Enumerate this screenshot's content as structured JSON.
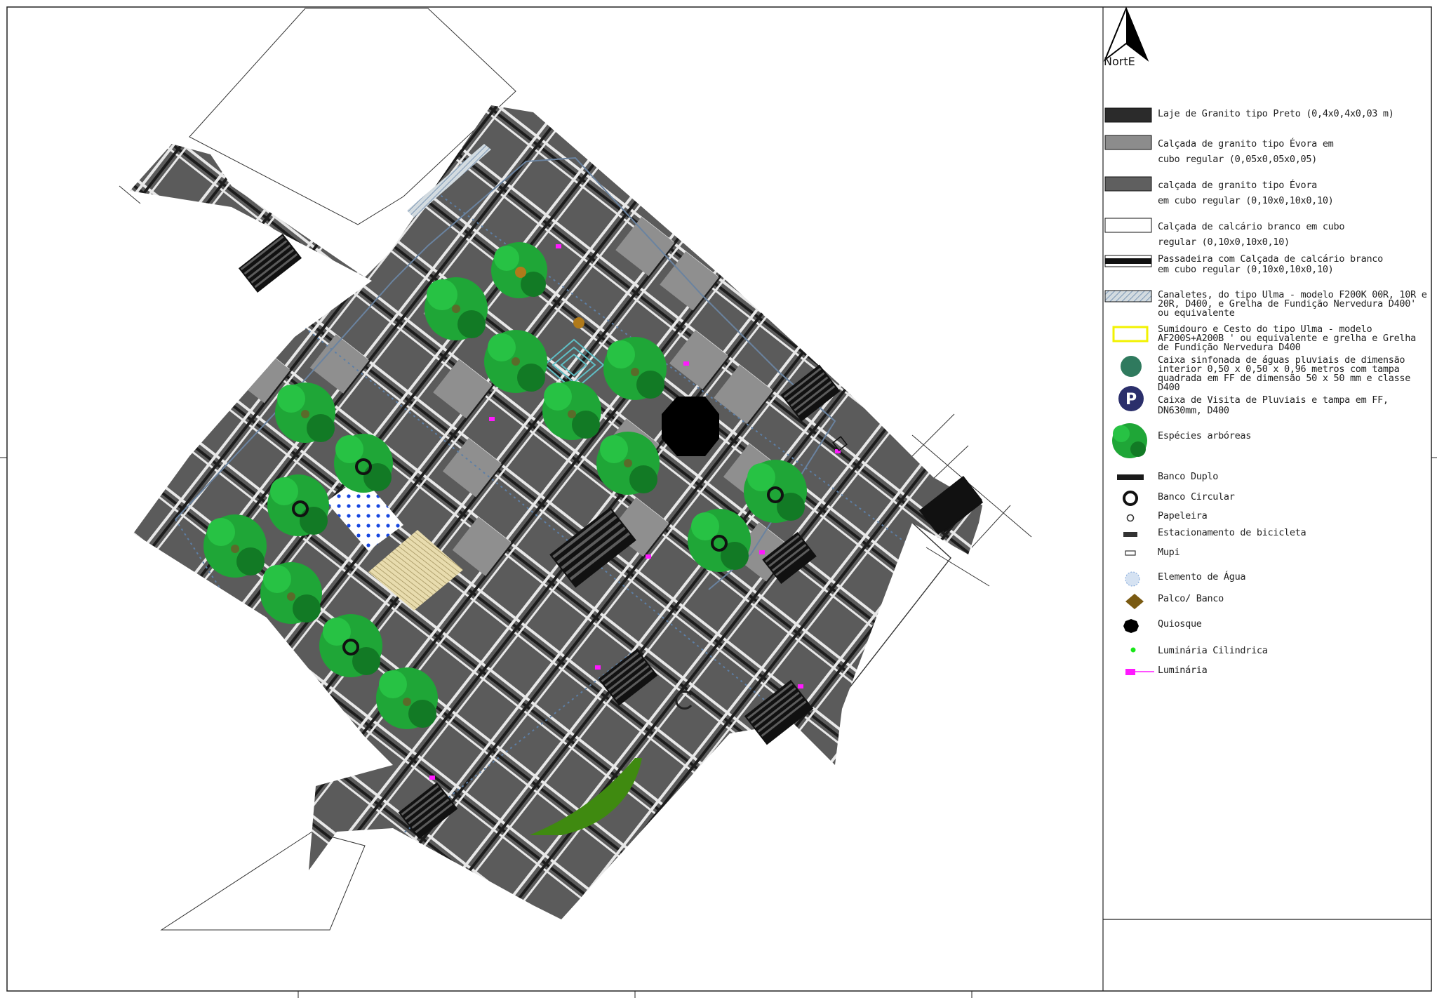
{
  "north": {
    "label": "NortE"
  },
  "legend": [
    {
      "id": "laje-granito-preto",
      "lines": [
        "Laje de Granito tipo Preto (0,4x0,4x0,03 m)"
      ],
      "symbol": "rect",
      "fill": "#2b2b2b"
    },
    {
      "id": "calcada-evora-cubo",
      "lines": [
        "Calçada de granito tipo Évora em",
        "cubo regular (0,05x0,05x0,05)"
      ],
      "symbol": "rect",
      "fill": "#8c8c8c"
    },
    {
      "id": "calcada-evora-10",
      "lines": [
        "calçada de granito tipo Évora",
        "em cubo regular (0,10x0,10x0,10)"
      ],
      "symbol": "rect",
      "fill": "#5f5f5f"
    },
    {
      "id": "calcada-calcario-branco",
      "lines": [
        "Calçada de calcário branco em cubo",
        "regular (0,10x0,10x0,10)"
      ],
      "symbol": "rect",
      "fill": "#ffffff"
    },
    {
      "id": "passadeira",
      "lines": [
        "Passadeira com Calçada de calcário branco",
        "em cubo regular (0,10x0,10x0,10)"
      ],
      "symbol": "stripe",
      "fill": "#111111"
    },
    {
      "id": "canaletes",
      "lines": [
        "Canaletes, do tipo Ulma - modelo F200K 00R, 10R e",
        "20R, D400, e Grelha de Fundição Nervedura D400'",
        "ou equivalente"
      ],
      "symbol": "hatch",
      "fill": "#b9c6cf"
    },
    {
      "id": "sumidouro",
      "lines": [
        "Sumidouro e Cesto do tipo Ulma - modelo",
        "AF200S+A200B ' ou equivalente e grelha e Grelha",
        "de Fundição Nervedura D400"
      ],
      "symbol": "yellow-rect",
      "fill": "#f2f200"
    },
    {
      "id": "caixa-sifonada",
      "lines": [
        "Caixa sinfonada de águas pluviais de dimensão",
        "interior 0,50 x 0,50 x 0,96 metros com tampa",
        "quadrada em FF  de dimensão 50 x 50 mm e classe",
        "D400"
      ],
      "symbol": "green-circle",
      "fill": "#2f7a5e"
    },
    {
      "id": "caixa-visita",
      "lines": [
        "Caixa de Visita de Pluviais e tampa em FF,",
        "DN630mm, D400"
      ],
      "symbol": "p-circle",
      "fill": "#2b2f6b",
      "symbol_text": "P"
    },
    {
      "id": "especies-arboreas",
      "lines": [
        "Espécies arbóreas"
      ],
      "symbol": "tree",
      "fill": "#22b33a"
    },
    {
      "id": "banco-duplo",
      "lines": [
        "Banco Duplo"
      ],
      "symbol": "bar",
      "fill": "#1a1a1a"
    },
    {
      "id": "banco-circular",
      "lines": [
        "Banco Circular"
      ],
      "symbol": "ring",
      "fill": "#111111"
    },
    {
      "id": "papeleira",
      "lines": [
        "Papeleira"
      ],
      "symbol": "small-circle",
      "fill": "#333333"
    },
    {
      "id": "estacionamento-bicicleta",
      "lines": [
        "Estacionamento de bicicleta"
      ],
      "symbol": "small-bar",
      "fill": "#333333"
    },
    {
      "id": "mupi",
      "lines": [
        "Mupi"
      ],
      "symbol": "small-rect",
      "fill": "#ffffff"
    },
    {
      "id": "elemento-agua",
      "lines": [
        "Elemento de Água"
      ],
      "symbol": "water",
      "fill": "#7fa6d9"
    },
    {
      "id": "palco-banco",
      "lines": [
        "Palco/ Banco"
      ],
      "symbol": "diamond",
      "fill": "#7a5a12"
    },
    {
      "id": "quiosque",
      "lines": [
        "Quiosque"
      ],
      "symbol": "octagon",
      "fill": "#000000"
    },
    {
      "id": "luminaria-cilindrica",
      "lines": [
        "Luminária Cilindrica"
      ],
      "symbol": "dot",
      "fill": "#19e619"
    },
    {
      "id": "luminaria",
      "lines": [
        "Luminária"
      ],
      "symbol": "lamp",
      "fill": "#ff19ff"
    }
  ],
  "colors": {
    "paving_dark": "#5b5b5b",
    "paving_light": "#8f8f8f",
    "crosswalk": "#111111",
    "tree": "#1fa637",
    "tree_dark": "#127a25",
    "kiosk": "#000000",
    "lawn": "#3f8a10",
    "water_dots": "#1847e0",
    "stage": "#d8c88f",
    "pipe": "#5d7fa6"
  }
}
